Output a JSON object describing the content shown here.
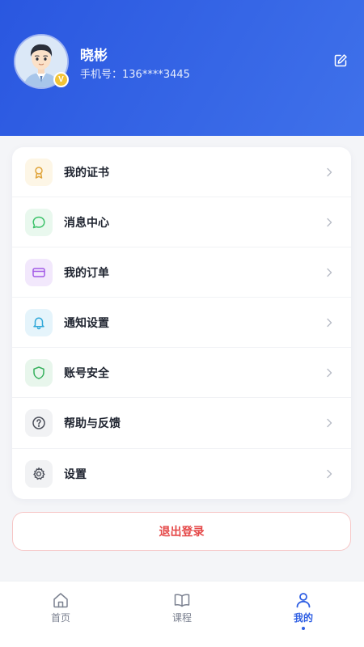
{
  "profile": {
    "name": "晓彬",
    "phone": "手机号：136****3445",
    "badge": "V",
    "avatar_icon": "user-avatar-icon",
    "edit_icon": "edit-icon"
  },
  "menu": {
    "items": [
      {
        "label": "我的证书",
        "icon": "certificate-icon",
        "color": "#e0a43a",
        "bg": "#fdf6e6"
      },
      {
        "label": "消息中心",
        "icon": "message-icon",
        "color": "#3cc26a",
        "bg": "#e9f8ee"
      },
      {
        "label": "我的订单",
        "icon": "card-icon",
        "color": "#a25be6",
        "bg": "#f2e8fc"
      },
      {
        "label": "通知设置",
        "icon": "bell-icon",
        "color": "#2ea7d8",
        "bg": "#e5f4fb"
      },
      {
        "label": "账号安全",
        "icon": "shield-icon",
        "color": "#35b05c",
        "bg": "#e8f6ec"
      },
      {
        "label": "帮助与反馈",
        "icon": "help-icon",
        "color": "#4b4f5a",
        "bg": "#f1f2f4"
      },
      {
        "label": "设置",
        "icon": "gear-icon",
        "color": "#4b4f5a",
        "bg": "#f1f2f4"
      }
    ]
  },
  "logout": {
    "label": "退出登录",
    "color": "#e54848"
  },
  "tabbar": {
    "tabs": [
      {
        "label": "首页",
        "icon": "home-icon",
        "active": false
      },
      {
        "label": "课程",
        "icon": "book-icon",
        "active": false
      },
      {
        "label": "我的",
        "icon": "person-icon",
        "active": true
      }
    ]
  },
  "colors": {
    "brand": "#2f5fe3",
    "header_start": "#2a57e0",
    "header_end": "#3f71ea"
  }
}
